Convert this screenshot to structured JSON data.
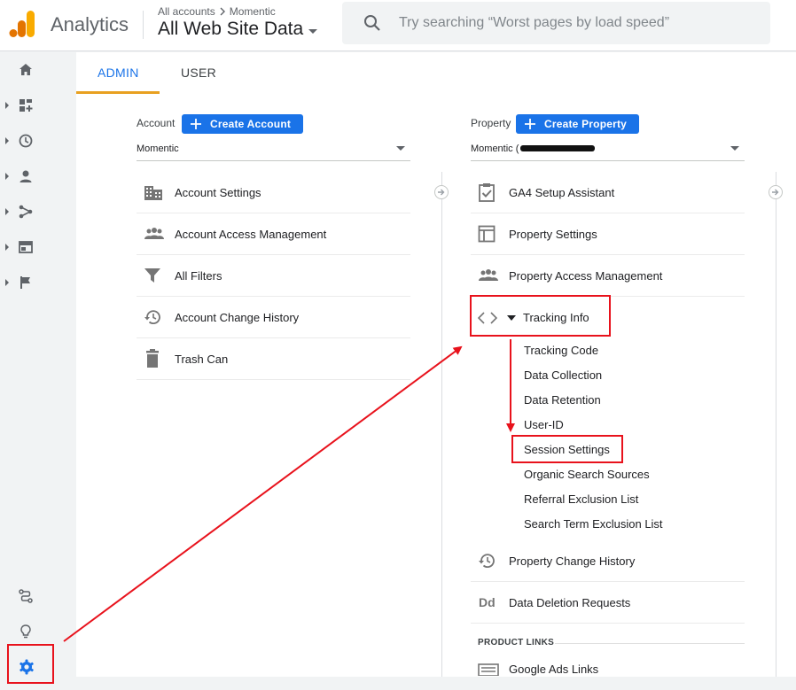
{
  "header": {
    "app_name": "Analytics",
    "breadcrumb_root": "All accounts",
    "breadcrumb_account": "Momentic",
    "property_view": "All Web Site Data",
    "search_placeholder": "Try searching “Worst pages by load speed”"
  },
  "tabs": [
    {
      "label": "ADMIN",
      "active": true
    },
    {
      "label": "USER",
      "active": false
    }
  ],
  "account_column": {
    "label": "Account",
    "create_button": "Create Account",
    "selected": "Momentic",
    "items": [
      {
        "label": "Account Settings",
        "icon": "building-icon"
      },
      {
        "label": "Account Access Management",
        "icon": "people-icon"
      },
      {
        "label": "All Filters",
        "icon": "filter-icon"
      },
      {
        "label": "Account Change History",
        "icon": "history-icon"
      },
      {
        "label": "Trash Can",
        "icon": "trash-icon"
      }
    ]
  },
  "property_column": {
    "label": "Property",
    "create_button": "Create Property",
    "selected": "Momentic (",
    "items": [
      {
        "label": "GA4 Setup Assistant",
        "icon": "clipboard-check-icon"
      },
      {
        "label": "Property Settings",
        "icon": "layout-icon"
      },
      {
        "label": "Property Access Management",
        "icon": "people-icon"
      },
      {
        "label": "Tracking Info",
        "icon": "code-icon",
        "expanded": true
      }
    ],
    "tracking_sub_items": [
      "Tracking Code",
      "Data Collection",
      "Data Retention",
      "User-ID",
      "Session Settings",
      "Organic Search Sources",
      "Referral Exclusion List",
      "Search Term Exclusion List"
    ],
    "more_items": [
      {
        "label": "Property Change History",
        "icon": "history-icon"
      },
      {
        "label": "Data Deletion Requests",
        "icon": "dd-icon",
        "icon_text": "Dd"
      }
    ],
    "section_header": "PRODUCT LINKS",
    "links": [
      {
        "label": "Google Ads Links",
        "icon": "ads-link-icon"
      }
    ]
  },
  "colors": {
    "accent": "#1a73e8",
    "tab_underline": "#e8a020",
    "highlight": "#e8121c",
    "logo_orange": "#f9ab00",
    "logo_dark": "#e37400"
  }
}
